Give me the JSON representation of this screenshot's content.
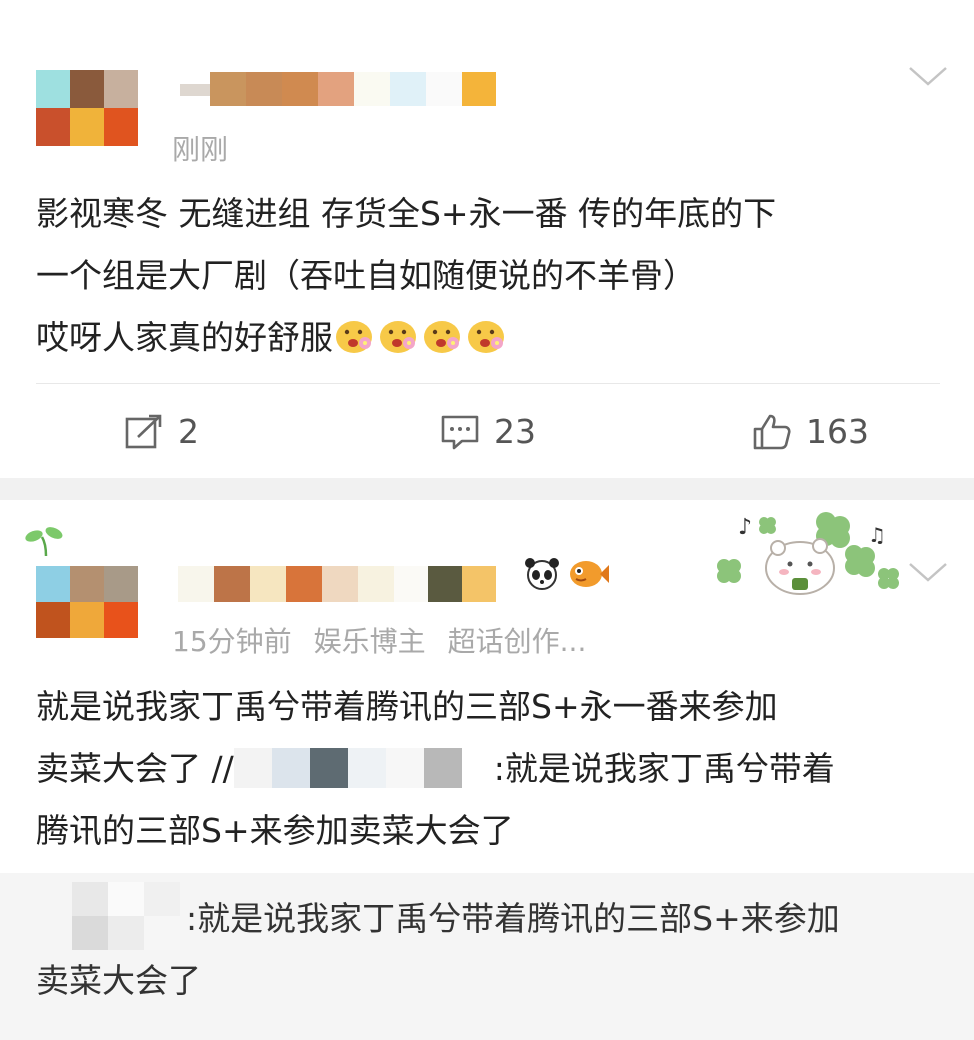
{
  "posts": [
    {
      "time": "刚刚",
      "text_lines": [
        "影视寒冬 无缝进组 存货全S+永一番 传的年底的下",
        "一个组是大厂剧（吞吐自如随便说的不羊骨）",
        "哎呀人家真的好舒服"
      ],
      "emoji_icons": [
        "flower-face-emoji",
        "flower-face-emoji",
        "flower-face-emoji",
        "flower-face-emoji"
      ],
      "actions": {
        "repost_count": "2",
        "comment_count": "23",
        "like_count": "163"
      }
    },
    {
      "time": "15分钟前",
      "tag1": "娱乐博主",
      "tag2": "超话创作...",
      "text_line1": "就是说我家丁禹兮带着腾讯的三部S+永一番来参加",
      "text_line2_a": "卖菜大会了 //",
      "text_line2_b": ":就是说我家丁禹兮带着",
      "text_line3": "腾讯的三部S+来参加卖菜大会了",
      "repost": {
        "line1": ":就是说我家丁禹兮带着腾讯的三部S+来参加",
        "line2": "卖菜大会了"
      }
    }
  ],
  "colors": {
    "text": "#222222",
    "meta": "#a9a9a9",
    "background": "#f1f1f1",
    "card": "#ffffff"
  }
}
